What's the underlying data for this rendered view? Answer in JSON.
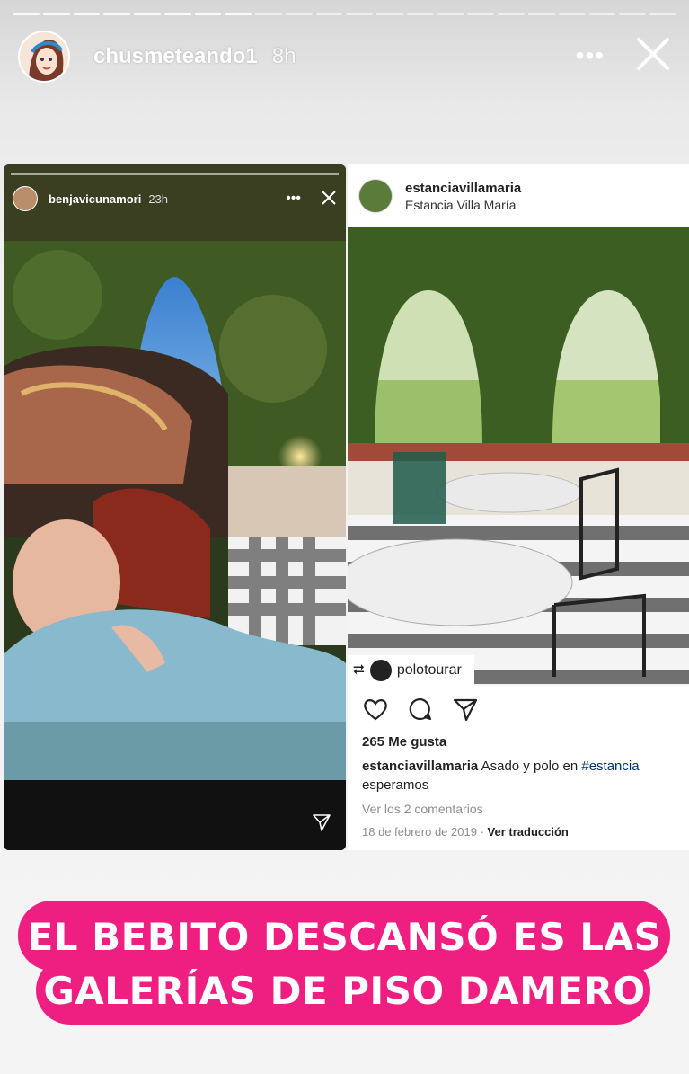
{
  "story": {
    "username": "chusmeteando1",
    "time": "8h",
    "more_icon": "more-dots-icon",
    "close_icon": "close-icon"
  },
  "left_story": {
    "username": "benjavicunamori",
    "time": "23h",
    "more_icon": "more-dots-icon",
    "close_icon": "close-icon",
    "send_icon": "send-icon"
  },
  "post": {
    "username": "estanciavillamaria",
    "location": "Estancia Villa María",
    "repost_user": "polotourar",
    "likes": "265 Me gusta",
    "caption_user": "estanciavillamaria",
    "caption_text": "Asado y polo en",
    "caption_tag": "#estancia",
    "caption_line2": "esperamos",
    "comments": "Ver los 2 comentarios",
    "date": "18 de febrero de 2019",
    "separator": "·",
    "translate": "Ver traducción"
  },
  "overlay": {
    "line1": "EL BEBITO DESCANSÓ ES LAS",
    "line2": "GALERÍAS DE PISO DAMERO"
  },
  "colors": {
    "accent_pink": "#ee1f80",
    "hashtag_blue": "#00376b"
  }
}
